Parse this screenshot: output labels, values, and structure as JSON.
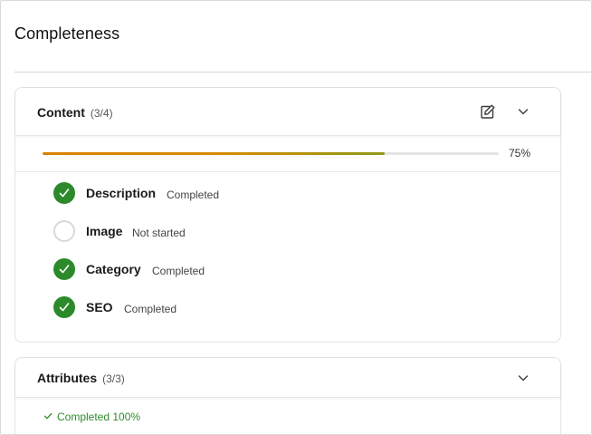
{
  "page": {
    "title": "Completeness"
  },
  "content_section": {
    "title": "Content",
    "count": "(3/4)",
    "progress": {
      "value": 0.75,
      "label": "75%"
    },
    "tasks": [
      {
        "name": "Description",
        "status": "Completed",
        "done": true
      },
      {
        "name": "Image",
        "status": "Not started",
        "done": false
      },
      {
        "name": "Category",
        "status": "Completed",
        "done": true
      },
      {
        "name": "SEO",
        "status": "Completed",
        "done": true
      }
    ]
  },
  "attributes_section": {
    "title": "Attributes",
    "count": "(3/3)",
    "completed_note": "Completed 100%"
  },
  "icons": {
    "edit": "pencil-edit-icon",
    "collapse": "chevron-down-icon",
    "done": "check-circle-icon",
    "todo": "empty-circle-icon",
    "check": "check-icon"
  },
  "colors": {
    "done_green": "#2d8a2a",
    "progress_orange": "#d98100",
    "progress_olive": "#8f9a17",
    "note_green": "#2f8a2c"
  }
}
